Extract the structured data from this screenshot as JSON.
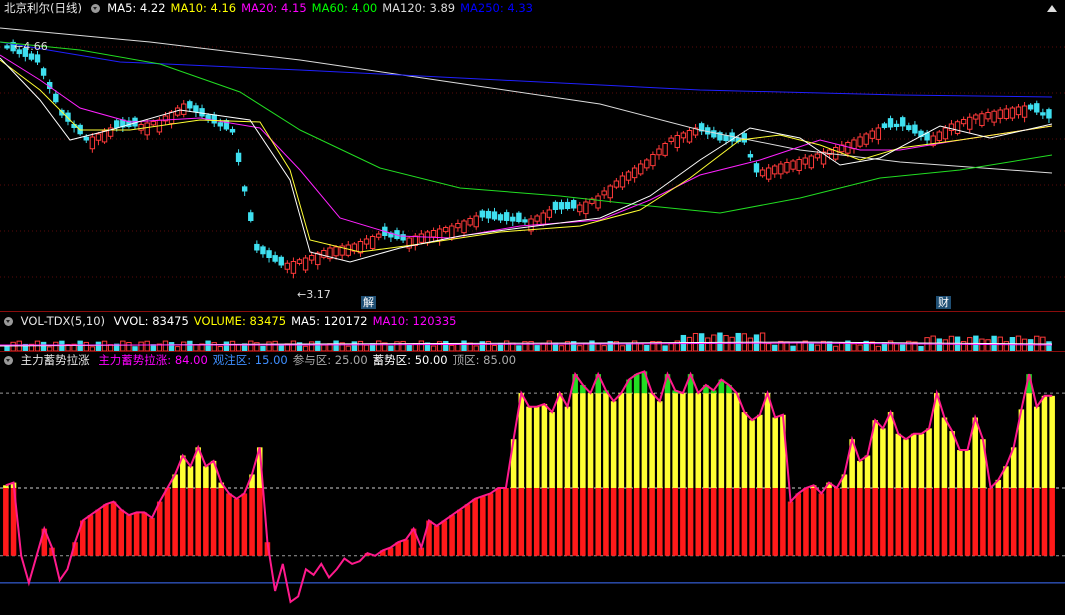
{
  "price_panel": {
    "title": "北京利尔(日线)",
    "indicators": [
      {
        "label": "MA5: 4.22",
        "color": "#ffffff"
      },
      {
        "label": "MA10: 4.16",
        "color": "#ffff00"
      },
      {
        "label": "MA20: 4.15",
        "color": "#ff00ff"
      },
      {
        "label": "MA60: 4.00",
        "color": "#00ff00"
      },
      {
        "label": "MA120: 3.89",
        "color": "#dcdcdc"
      },
      {
        "label": "MA250: 4.33",
        "color": "#0000ff"
      }
    ],
    "high_label": "4.66",
    "low_label": "3.17",
    "marker_jie": "解",
    "marker_cai": "财"
  },
  "volume_panel": {
    "title": "VOL-TDX(5,10)",
    "indicators": [
      {
        "label": "VVOL: 83475",
        "color": "#ffffff"
      },
      {
        "label": "VOLUME: 83475",
        "color": "#ffff00"
      },
      {
        "label": "MA5: 120172",
        "color": "#ffffff"
      },
      {
        "label": "MA10: 120335",
        "color": "#ff00ff"
      }
    ]
  },
  "indicator_panel": {
    "title": "主力蓄势拉涨",
    "indicators": [
      {
        "label": "主力蓄势拉涨: 84.00",
        "color": "#ff00ff"
      },
      {
        "label": "观注区: 15.00",
        "color": "#3f8fff"
      },
      {
        "label": "参与区: 25.00",
        "color": "#aaaaaa"
      },
      {
        "label": "蓄势区: 50.00",
        "color": "#ffffff"
      },
      {
        "label": "顶区: 85.00",
        "color": "#aaaaaa"
      }
    ]
  },
  "chart_data": {
    "type": "bar",
    "title": "主力蓄势拉涨",
    "levels": {
      "观注区": 15,
      "参与区": 25,
      "蓄势区": 50,
      "顶区": 85
    },
    "ylim": [
      5,
      95
    ],
    "values": [
      51,
      52,
      25,
      15,
      25,
      35,
      28,
      16,
      20,
      30,
      38,
      40,
      42,
      44,
      45,
      42,
      40,
      41,
      41,
      39,
      45,
      50,
      55,
      62,
      58,
      65,
      58,
      60,
      52,
      48,
      46,
      48,
      55,
      65,
      30,
      12,
      22,
      8,
      10,
      20,
      18,
      22,
      17,
      20,
      24,
      22,
      23,
      26,
      25,
      27,
      28,
      30,
      31,
      35,
      28,
      38,
      36,
      38,
      40,
      42,
      44,
      46,
      47,
      48,
      50,
      50,
      68,
      85,
      80,
      80,
      81,
      78,
      85,
      80,
      92,
      88,
      85,
      92,
      86,
      82,
      85,
      90,
      92,
      93,
      85,
      82,
      92,
      86,
      85,
      92,
      85,
      88,
      86,
      90,
      88,
      85,
      78,
      75,
      77,
      85,
      76,
      77,
      45,
      48,
      50,
      51,
      48,
      52,
      50,
      55,
      68,
      60,
      62,
      75,
      72,
      78,
      70,
      68,
      70,
      70,
      72,
      85,
      76,
      71,
      64,
      64,
      76,
      68,
      50,
      53,
      58,
      65,
      79,
      92,
      80,
      84,
      84
    ]
  }
}
